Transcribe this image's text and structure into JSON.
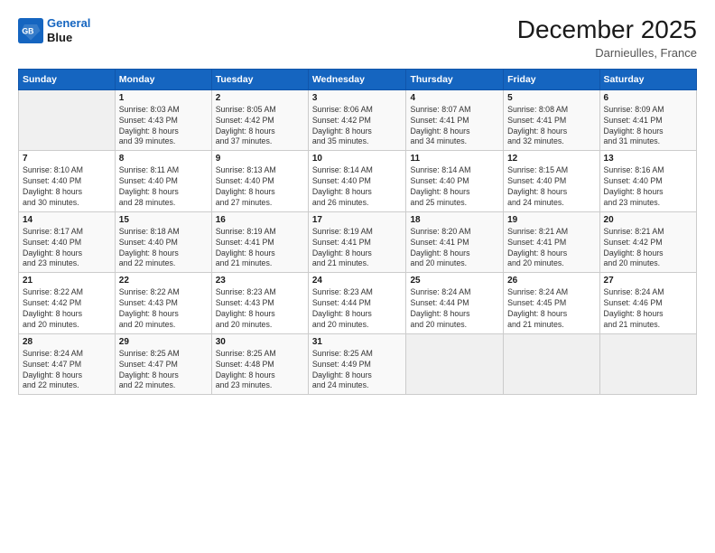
{
  "logo": {
    "line1": "General",
    "line2": "Blue"
  },
  "title": "December 2025",
  "subtitle": "Darnieulles, France",
  "header_days": [
    "Sunday",
    "Monday",
    "Tuesday",
    "Wednesday",
    "Thursday",
    "Friday",
    "Saturday"
  ],
  "weeks": [
    [
      {
        "num": "",
        "info": ""
      },
      {
        "num": "1",
        "info": "Sunrise: 8:03 AM\nSunset: 4:43 PM\nDaylight: 8 hours\nand 39 minutes."
      },
      {
        "num": "2",
        "info": "Sunrise: 8:05 AM\nSunset: 4:42 PM\nDaylight: 8 hours\nand 37 minutes."
      },
      {
        "num": "3",
        "info": "Sunrise: 8:06 AM\nSunset: 4:42 PM\nDaylight: 8 hours\nand 35 minutes."
      },
      {
        "num": "4",
        "info": "Sunrise: 8:07 AM\nSunset: 4:41 PM\nDaylight: 8 hours\nand 34 minutes."
      },
      {
        "num": "5",
        "info": "Sunrise: 8:08 AM\nSunset: 4:41 PM\nDaylight: 8 hours\nand 32 minutes."
      },
      {
        "num": "6",
        "info": "Sunrise: 8:09 AM\nSunset: 4:41 PM\nDaylight: 8 hours\nand 31 minutes."
      }
    ],
    [
      {
        "num": "7",
        "info": "Sunrise: 8:10 AM\nSunset: 4:40 PM\nDaylight: 8 hours\nand 30 minutes."
      },
      {
        "num": "8",
        "info": "Sunrise: 8:11 AM\nSunset: 4:40 PM\nDaylight: 8 hours\nand 28 minutes."
      },
      {
        "num": "9",
        "info": "Sunrise: 8:13 AM\nSunset: 4:40 PM\nDaylight: 8 hours\nand 27 minutes."
      },
      {
        "num": "10",
        "info": "Sunrise: 8:14 AM\nSunset: 4:40 PM\nDaylight: 8 hours\nand 26 minutes."
      },
      {
        "num": "11",
        "info": "Sunrise: 8:14 AM\nSunset: 4:40 PM\nDaylight: 8 hours\nand 25 minutes."
      },
      {
        "num": "12",
        "info": "Sunrise: 8:15 AM\nSunset: 4:40 PM\nDaylight: 8 hours\nand 24 minutes."
      },
      {
        "num": "13",
        "info": "Sunrise: 8:16 AM\nSunset: 4:40 PM\nDaylight: 8 hours\nand 23 minutes."
      }
    ],
    [
      {
        "num": "14",
        "info": "Sunrise: 8:17 AM\nSunset: 4:40 PM\nDaylight: 8 hours\nand 23 minutes."
      },
      {
        "num": "15",
        "info": "Sunrise: 8:18 AM\nSunset: 4:40 PM\nDaylight: 8 hours\nand 22 minutes."
      },
      {
        "num": "16",
        "info": "Sunrise: 8:19 AM\nSunset: 4:41 PM\nDaylight: 8 hours\nand 21 minutes."
      },
      {
        "num": "17",
        "info": "Sunrise: 8:19 AM\nSunset: 4:41 PM\nDaylight: 8 hours\nand 21 minutes."
      },
      {
        "num": "18",
        "info": "Sunrise: 8:20 AM\nSunset: 4:41 PM\nDaylight: 8 hours\nand 20 minutes."
      },
      {
        "num": "19",
        "info": "Sunrise: 8:21 AM\nSunset: 4:41 PM\nDaylight: 8 hours\nand 20 minutes."
      },
      {
        "num": "20",
        "info": "Sunrise: 8:21 AM\nSunset: 4:42 PM\nDaylight: 8 hours\nand 20 minutes."
      }
    ],
    [
      {
        "num": "21",
        "info": "Sunrise: 8:22 AM\nSunset: 4:42 PM\nDaylight: 8 hours\nand 20 minutes."
      },
      {
        "num": "22",
        "info": "Sunrise: 8:22 AM\nSunset: 4:43 PM\nDaylight: 8 hours\nand 20 minutes."
      },
      {
        "num": "23",
        "info": "Sunrise: 8:23 AM\nSunset: 4:43 PM\nDaylight: 8 hours\nand 20 minutes."
      },
      {
        "num": "24",
        "info": "Sunrise: 8:23 AM\nSunset: 4:44 PM\nDaylight: 8 hours\nand 20 minutes."
      },
      {
        "num": "25",
        "info": "Sunrise: 8:24 AM\nSunset: 4:44 PM\nDaylight: 8 hours\nand 20 minutes."
      },
      {
        "num": "26",
        "info": "Sunrise: 8:24 AM\nSunset: 4:45 PM\nDaylight: 8 hours\nand 21 minutes."
      },
      {
        "num": "27",
        "info": "Sunrise: 8:24 AM\nSunset: 4:46 PM\nDaylight: 8 hours\nand 21 minutes."
      }
    ],
    [
      {
        "num": "28",
        "info": "Sunrise: 8:24 AM\nSunset: 4:47 PM\nDaylight: 8 hours\nand 22 minutes."
      },
      {
        "num": "29",
        "info": "Sunrise: 8:25 AM\nSunset: 4:47 PM\nDaylight: 8 hours\nand 22 minutes."
      },
      {
        "num": "30",
        "info": "Sunrise: 8:25 AM\nSunset: 4:48 PM\nDaylight: 8 hours\nand 23 minutes."
      },
      {
        "num": "31",
        "info": "Sunrise: 8:25 AM\nSunset: 4:49 PM\nDaylight: 8 hours\nand 24 minutes."
      },
      {
        "num": "",
        "info": ""
      },
      {
        "num": "",
        "info": ""
      },
      {
        "num": "",
        "info": ""
      }
    ]
  ]
}
